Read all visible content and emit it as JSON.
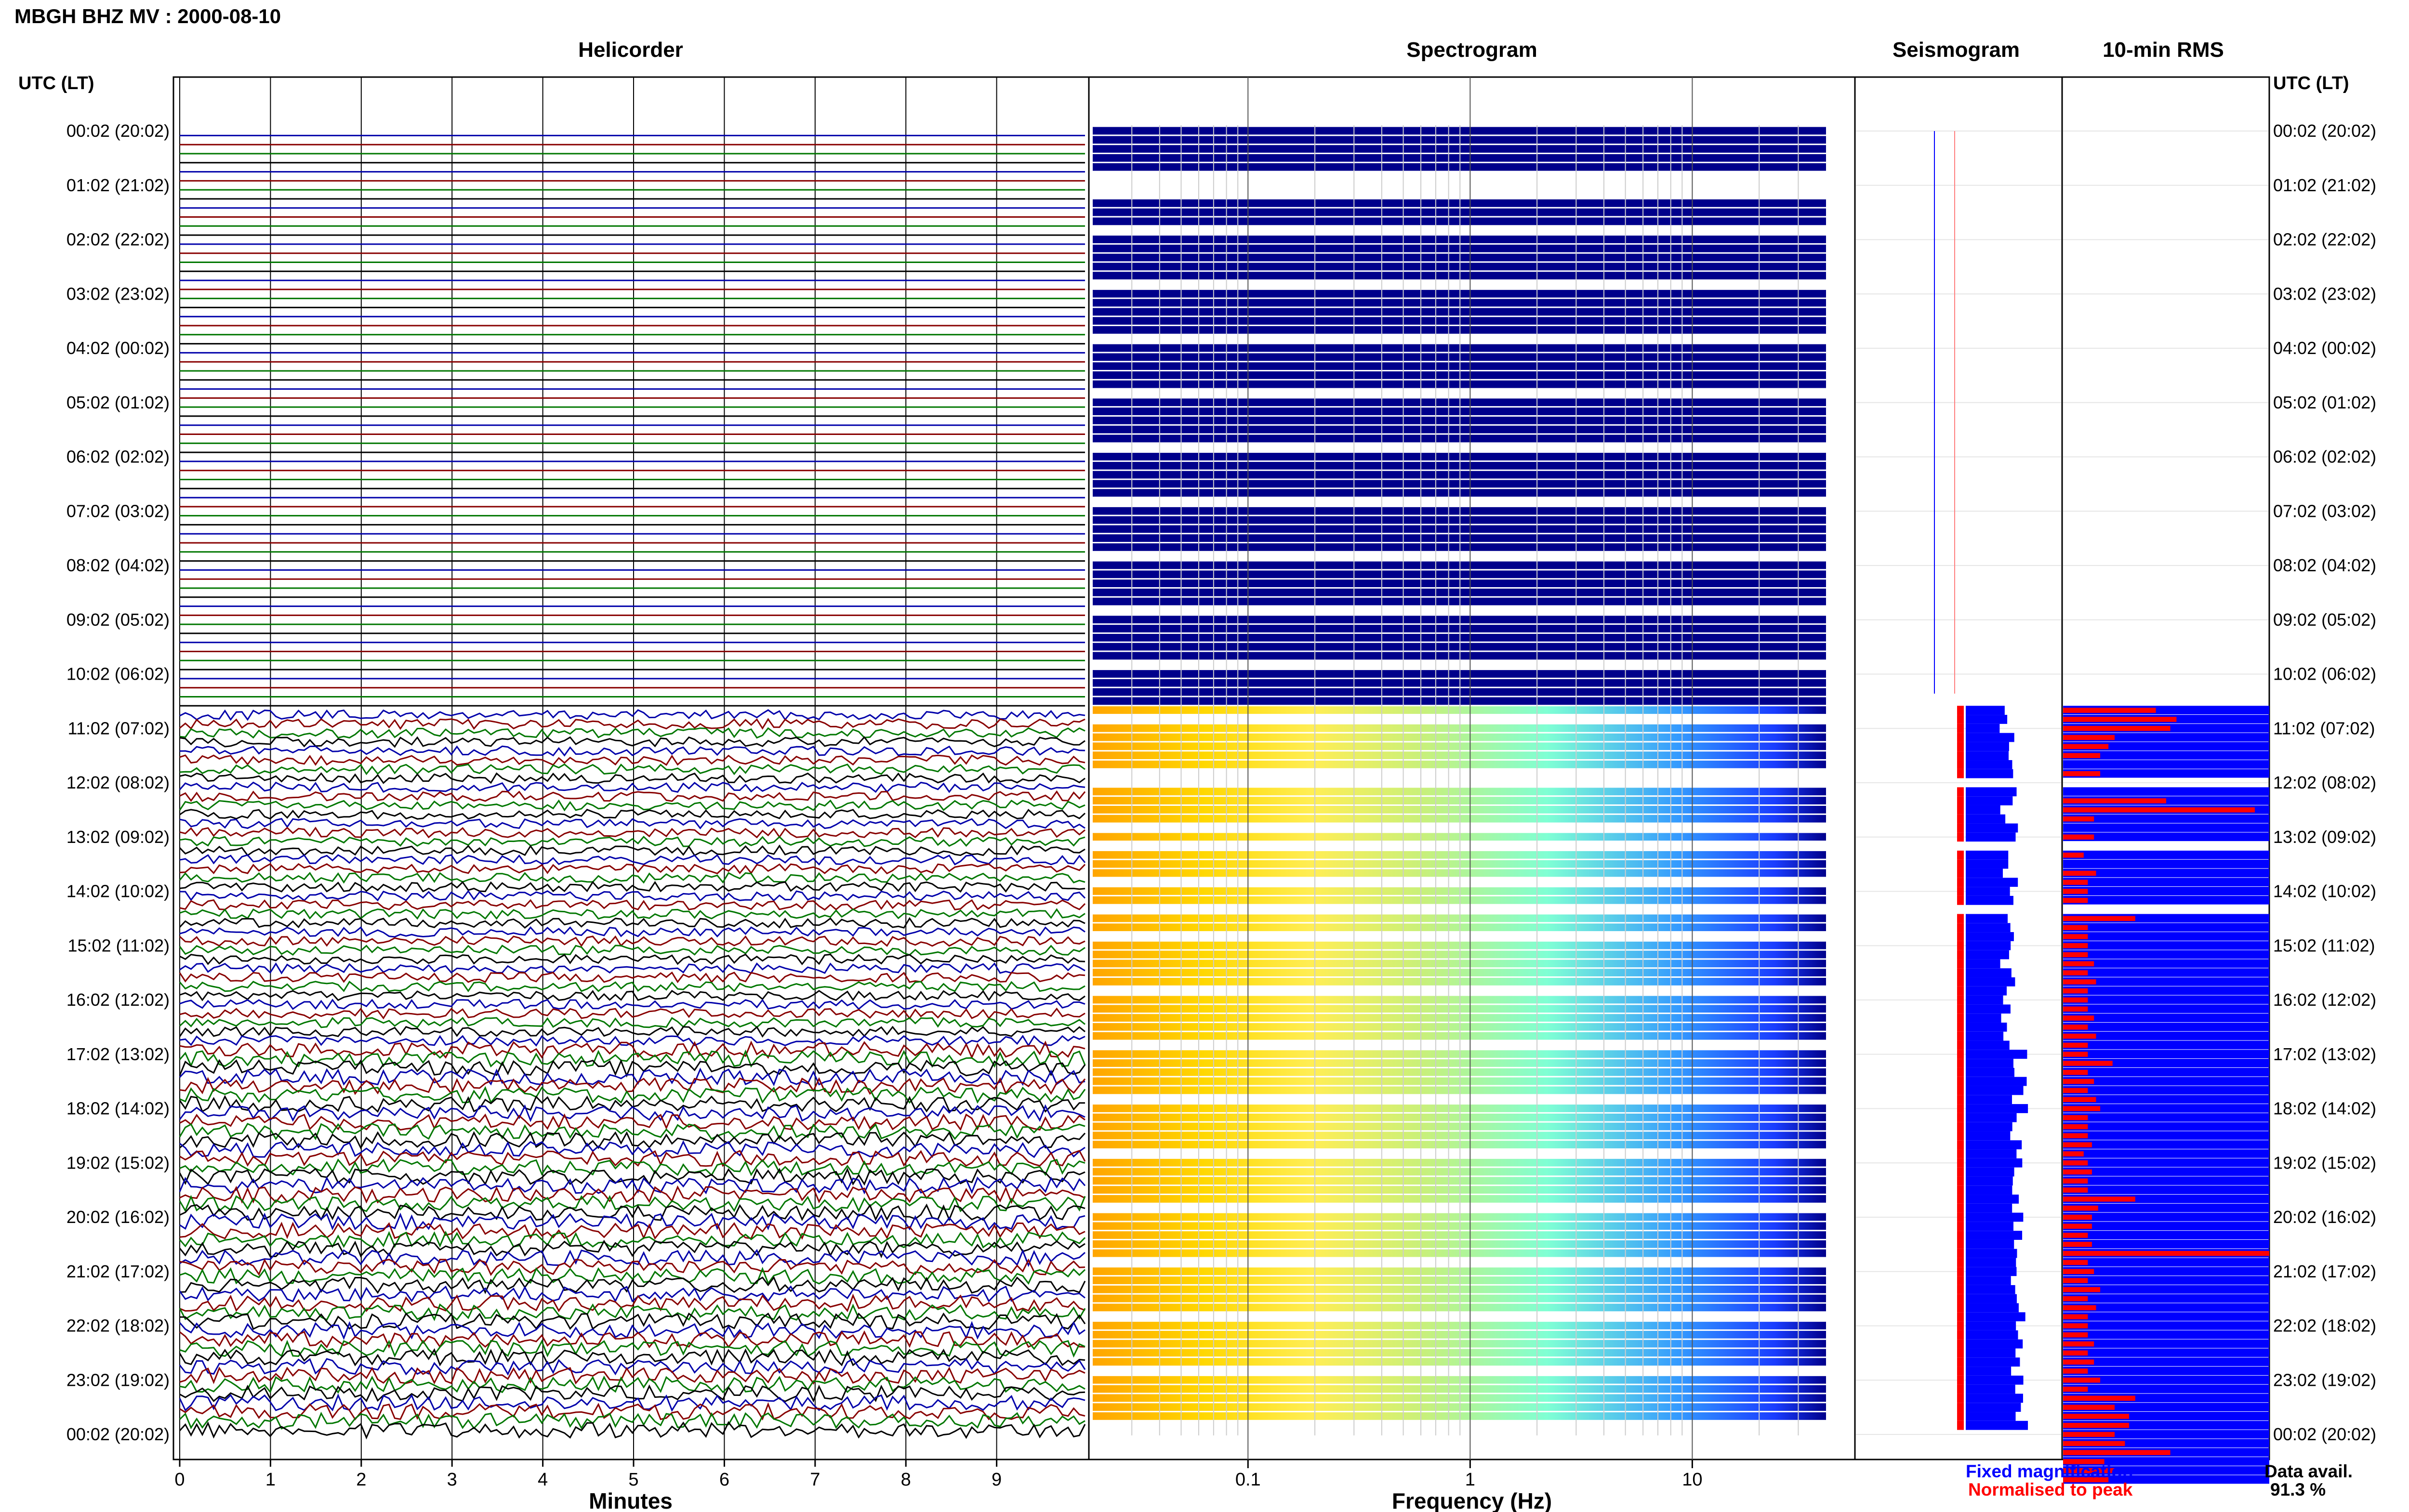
{
  "title": "MBGH BHZ MV : 2000-08-10",
  "panels": {
    "helicorder": "Helicorder",
    "spectrogram": "Spectrogram",
    "seismogram": "Seismogram",
    "rms": "10-min RMS"
  },
  "time_axis_label": "UTC (LT)",
  "time_labels": [
    "00:02 (20:02)",
    "01:02 (21:02)",
    "02:02 (22:02)",
    "03:02 (23:02)",
    "04:02 (00:02)",
    "05:02 (01:02)",
    "06:02 (02:02)",
    "07:02 (03:02)",
    "08:02 (04:02)",
    "09:02 (05:02)",
    "10:02 (06:02)",
    "11:02 (07:02)",
    "12:02 (08:02)",
    "13:02 (09:02)",
    "14:02 (10:02)",
    "15:02 (11:02)",
    "16:02 (12:02)",
    "17:02 (13:02)",
    "18:02 (14:02)",
    "19:02 (15:02)",
    "20:02 (16:02)",
    "21:02 (17:02)",
    "22:02 (18:02)",
    "23:02 (19:02)",
    "00:02 (20:02)"
  ],
  "helicorder_xlabel": "Minutes",
  "helicorder_ticks": [
    "0",
    "1",
    "2",
    "3",
    "4",
    "5",
    "6",
    "7",
    "8",
    "9"
  ],
  "spectrogram_xlabel": "Frequency (Hz)",
  "spectrogram_ticks": [
    "0.1",
    "1",
    "10"
  ],
  "legend": {
    "fixed": "Fixed magnification",
    "normalised": "Normalised to peak",
    "fixed_color": "#0000ff",
    "normalised_color": "#ff0000"
  },
  "data_avail_label": "Data avail.",
  "data_avail_value": "91.3 %",
  "colors": {
    "trace_cycle": [
      "#0000aa",
      "#880000",
      "#007700",
      "#000000"
    ],
    "spectrogram_bg": "#00008b",
    "rms_bar": "#0000ff",
    "rms_norm": "#ff0000"
  },
  "chart_data": {
    "type": "heatmap",
    "station": "MBGH",
    "channel": "BHZ",
    "network": "MV",
    "date": "2000-08-10",
    "rows_per_hour": 6,
    "row_minutes": 10,
    "helicorder_xlim": [
      0,
      10
    ],
    "spectrogram_xlim_hz": [
      0.02,
      40
    ],
    "spectrogram_scale": "log",
    "data_availability_percent": 91.3,
    "data_gaps_utc": [
      "00:02-10:42",
      "12:02-12:12",
      "13:12-13:22",
      "14:22-14:32"
    ],
    "rms_relative": [
      0,
      0,
      0,
      0,
      0,
      0,
      0,
      0,
      0,
      0,
      0,
      0,
      0,
      0,
      0,
      0,
      0,
      0,
      0,
      0,
      0,
      0,
      0,
      0,
      0,
      0,
      0,
      0,
      0,
      0,
      0,
      0,
      0,
      0,
      0,
      0,
      0,
      0,
      0,
      0,
      0,
      0,
      0,
      0,
      0,
      0,
      0,
      0,
      0,
      0,
      0,
      0,
      0,
      0,
      0,
      0,
      0,
      0,
      0,
      0,
      0,
      0,
      0,
      0,
      0.45,
      0.55,
      0.52,
      0.25,
      0.22,
      0.18,
      0,
      0.18,
      0.15,
      0,
      0.5,
      0.93,
      0.15,
      0,
      0.15,
      0.1,
      0.1,
      0,
      0.16,
      0.12,
      0.12,
      0.12,
      0.12,
      0.35,
      0.12,
      0.12,
      0.12,
      0.12,
      0.15,
      0.12,
      0.16,
      0.12,
      0.12,
      0.12,
      0.15,
      0.12,
      0.16,
      0.12,
      0.12,
      0.24,
      0.12,
      0.15,
      0.12,
      0.16,
      0.18,
      0.12,
      0.12,
      0.12,
      0.14,
      0.1,
      0.12,
      0.14,
      0.12,
      0.12,
      0.35,
      0.17,
      0.14,
      0.14,
      0.12,
      0.14,
      1.0,
      0.12,
      0.15,
      0.12,
      0.18,
      0.12,
      0.16,
      0.12,
      0.12,
      0.12,
      0.15,
      0.12,
      0.15,
      0.12,
      0.18,
      0.12,
      0.35,
      0.25,
      0.32,
      0.32,
      0.25,
      0.3,
      0.52,
      0.2,
      0.25,
      0.22
    ]
  }
}
